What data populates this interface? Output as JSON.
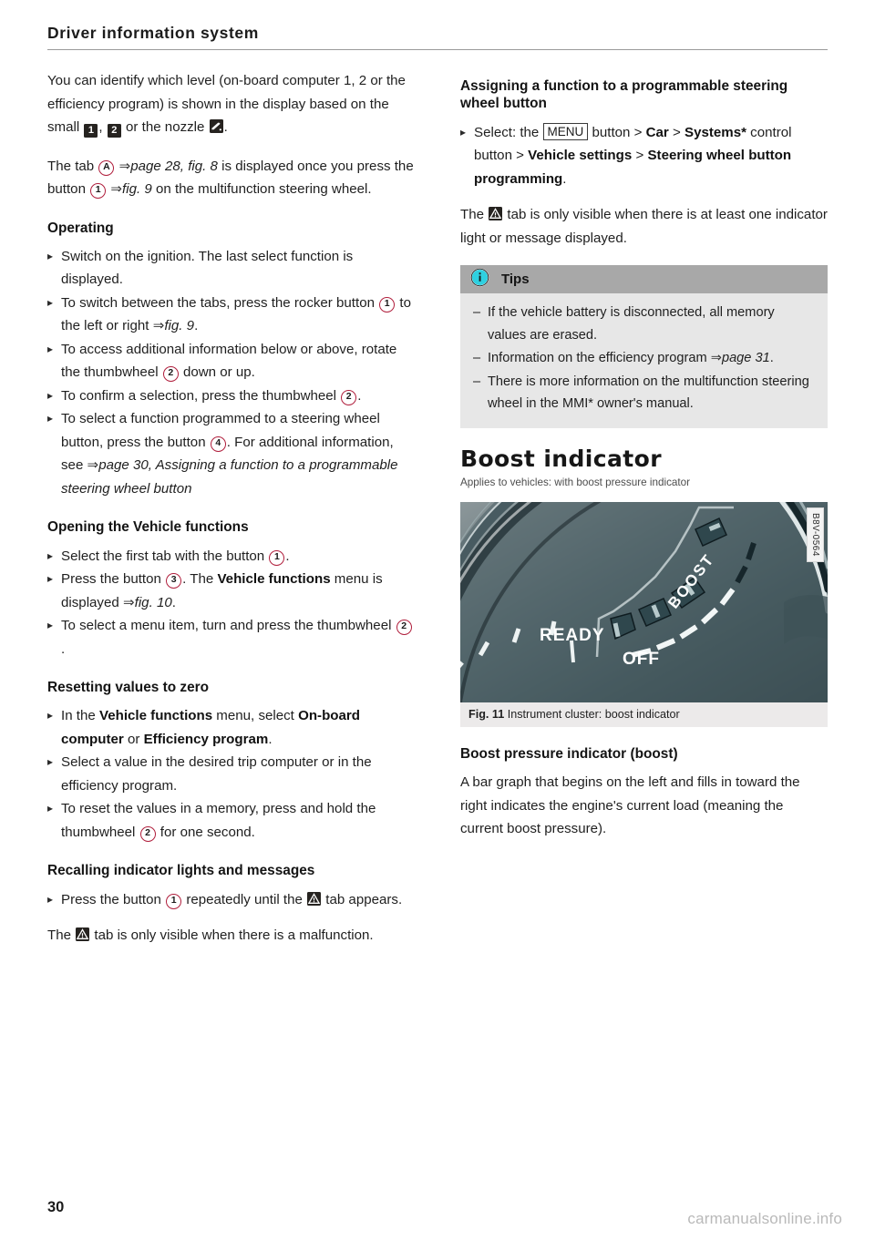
{
  "header": {
    "title": "Driver information system"
  },
  "footer": {
    "page_number": "30",
    "watermark": "carmanualsonline.info"
  },
  "left_column": {
    "intro_1": {
      "a": "You can identify which level (on-board computer 1, 2 or the efficiency program) is shown in the display based on the small ",
      "icon_1": "1",
      "b": ", ",
      "icon_2": "2",
      "c": " or the nozzle ",
      "d": "."
    },
    "intro_2": {
      "a": "The tab ",
      "marker_a": "A",
      "ref_1": "page 28, fig. 8",
      "b": " is displayed once you press the button ",
      "marker_1": "1",
      "ref_2": "fig. 9",
      "c": " on the multifunction steering wheel."
    },
    "operating_heading": "Operating",
    "operating_steps": [
      {
        "a": "Switch on the ignition. The last select function is displayed."
      },
      {
        "a": "To switch between the tabs, press the rocker button ",
        "marker": "1",
        "b": " to the left or right ",
        "ref": "fig. 9",
        "c": "."
      },
      {
        "a": "To access additional information below or above, rotate the thumbwheel ",
        "marker": "2",
        "b": " down or up."
      },
      {
        "a": "To confirm a selection, press the thumbwheel ",
        "marker": "2",
        "b": "."
      },
      {
        "a": "To select a function programmed to a steering wheel button, press the button ",
        "marker": "4",
        "b": ". For additional information, see ",
        "ref": "page 30, Assigning a function to a programmable steering wheel button",
        "c": ""
      }
    ],
    "opening_heading": "Opening the Vehicle functions",
    "opening_steps": [
      {
        "a": "Select the first tab with the button ",
        "marker": "1",
        "b": "."
      },
      {
        "a": "Press the button ",
        "marker": "3",
        "b": ". The ",
        "bold": "Vehicle functions",
        "c": " menu is displayed ",
        "ref": "fig. 10",
        "d": "."
      },
      {
        "a": "To select a menu item, turn and press the thumbwheel ",
        "marker": "2",
        "b": "."
      }
    ],
    "resetting_heading": "Resetting values to zero",
    "resetting_steps": [
      {
        "a": "In the ",
        "bold1": "Vehicle functions",
        "b": " menu, select ",
        "bold2": "On-board computer",
        "c": " or ",
        "bold3": "Efficiency program",
        "d": "."
      },
      {
        "a": "Select a value in the desired trip computer or in the efficiency program."
      },
      {
        "a": "To reset the values in a memory, press and hold the thumbwheel ",
        "marker": "2",
        "b": " for one second."
      }
    ],
    "recalling_heading": "Recalling indicator lights and messages",
    "recalling_steps": [
      {
        "a": "Press the button ",
        "marker": "1",
        "b": " repeatedly until the ",
        "icon": "warning-triangle",
        "c": " tab appears."
      }
    ],
    "recalling_note": {
      "a": "The ",
      "b": " tab is only visible when there is a malfunction."
    }
  },
  "right_column": {
    "assigning_heading": "Assigning a function to a programmable steering wheel button",
    "assigning_step": {
      "a": "Select: the ",
      "key": "MENU",
      "b": " button > ",
      "bold1": "Car",
      "c": " > ",
      "bold2": "Systems*",
      "d": " control button > ",
      "bold3": "Vehicle settings",
      "e": " > ",
      "bold4": "Steering wheel button programming",
      "f": "."
    },
    "assigning_note": {
      "a": "The ",
      "b": " tab is only visible when there is at least one indicator light or message displayed."
    },
    "tips": {
      "title": "Tips",
      "icon": "info-icon",
      "items": [
        {
          "a": "If the vehicle battery is disconnected, all memory values are erased."
        },
        {
          "a": "Information on the efficiency program ",
          "ref": "page 31",
          "b": "."
        },
        {
          "a": "There is more information on the multifunction steering wheel in the MMI* owner's manual."
        }
      ]
    },
    "boost_heading": "Boost indicator",
    "boost_applies": "Applies to vehicles: with boost pressure indicator",
    "figure": {
      "code": "B8V-0564",
      "caption_number": "Fig. 11",
      "caption_text": "Instrument cluster: boost indicator",
      "labels": {
        "ready": "READY",
        "off": "OFF",
        "boost": "BOOST"
      }
    },
    "boost_sub_heading": "Boost pressure indicator (boost)",
    "boost_body": "A bar graph that begins on the left and fills in toward the right indicates the engine's current load (meaning the current boost pressure)."
  },
  "colors": {
    "marker_red": "#b01e3c",
    "tips_header_gray": "#a8a8a8",
    "tips_body_gray": "#e7e7e7",
    "info_icon_cyan": "#2fd0e0",
    "gauge_dark": "#3f5358"
  }
}
